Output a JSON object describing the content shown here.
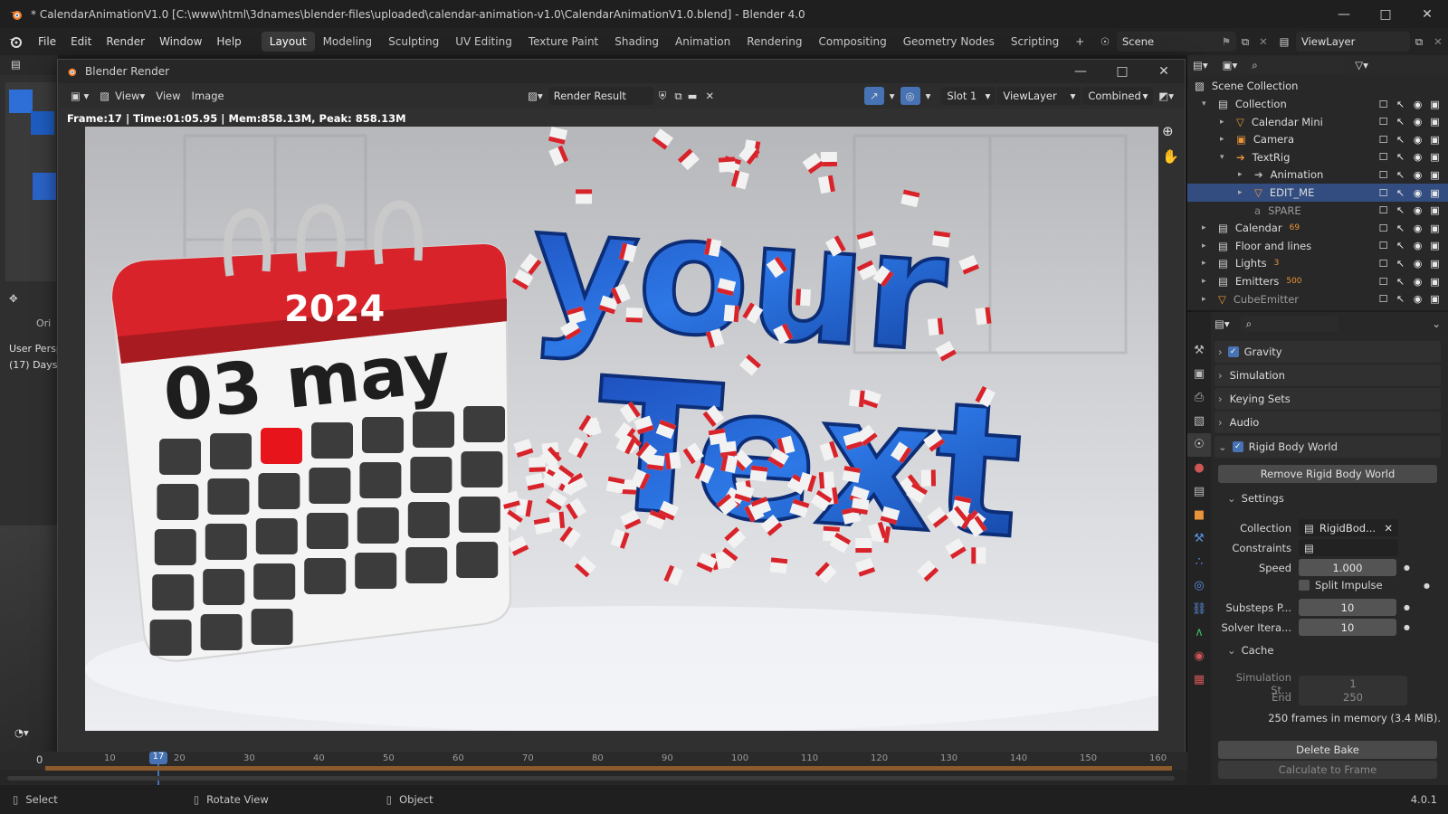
{
  "titlebar": {
    "title": "* CalendarAnimationV1.0 [C:\\www\\html\\3dnames\\blender-files\\uploaded\\calendar-animation-v1.0\\CalendarAnimationV1.0.blend] - Blender 4.0"
  },
  "menu": [
    "File",
    "Edit",
    "Render",
    "Window",
    "Help"
  ],
  "workspaces": [
    "Layout",
    "Modeling",
    "Sculpting",
    "UV Editing",
    "Texture Paint",
    "Shading",
    "Animation",
    "Rendering",
    "Compositing",
    "Geometry Nodes",
    "Scripting"
  ],
  "active_workspace": "Layout",
  "scene_name": "Scene",
  "view_layer_name": "ViewLayer",
  "left_viewport": {
    "orient": "Ori",
    "persp": "User Persp",
    "collection": "(17) Days"
  },
  "render_window": {
    "title": "Blender Render",
    "view_menu": "View",
    "view_menu2": "View",
    "image_menu": "Image",
    "image_name": "Render Result",
    "slot": "Slot 1",
    "view_layer": "ViewLayer",
    "pass": "Combined",
    "info": "Frame:17 | Time:01:05.95 | Mem:858.13M, Peak: 858.13M"
  },
  "render_image": {
    "year": "2024",
    "date": "03 may",
    "text_line1": "your",
    "text_line2": "Text"
  },
  "outliner": {
    "root": "Scene Collection",
    "items": [
      {
        "name": "Collection"
      },
      {
        "name": "Calendar Mini"
      },
      {
        "name": "Camera"
      },
      {
        "name": "TextRig"
      },
      {
        "name": "Animation"
      },
      {
        "name": "EDIT_ME"
      },
      {
        "name": "SPARE"
      },
      {
        "name": "Calendar",
        "badge": "69"
      },
      {
        "name": "Floor and lines"
      },
      {
        "name": "Lights",
        "badge": "3"
      },
      {
        "name": "Emitters",
        "badge": "500"
      },
      {
        "name": "CubeEmitter"
      }
    ]
  },
  "properties": {
    "panels": [
      "Gravity",
      "Simulation",
      "Keying Sets",
      "Audio",
      "Rigid Body World"
    ],
    "remove_button": "Remove Rigid Body World",
    "settings_label": "Settings",
    "collection_label": "Collection",
    "collection_value": "RigidBod...",
    "constraints_label": "Constraints",
    "speed_label": "Speed",
    "speed_value": "1.000",
    "split_impulse_label": "Split Impulse",
    "substeps_label": "Substeps P...",
    "substeps_value": "10",
    "solver_label": "Solver Itera...",
    "solver_value": "10",
    "cache_label": "Cache",
    "sim_start_label": "Simulation St...",
    "sim_start_value": "1",
    "end_label": "End",
    "end_value": "250",
    "memory_info": "250 frames in memory (3.4 MiB).",
    "delete_bake": "Delete Bake",
    "calc_to_frame": "Calculate to Frame"
  },
  "timeline": {
    "start_frame": "0",
    "current_frame": "17",
    "ticks": [
      "10",
      "20",
      "30",
      "40",
      "50",
      "60",
      "70",
      "80",
      "90",
      "100",
      "110",
      "120",
      "130",
      "140",
      "150",
      "160"
    ]
  },
  "statusbar": {
    "select": "Select",
    "rotate": "Rotate View",
    "object": "Object",
    "version": "4.0.1"
  },
  "colors": {
    "accent": "#4772b3",
    "selection": "#334d80",
    "calendar_red": "#d8232a",
    "text_blue": "#1d5fd0"
  }
}
